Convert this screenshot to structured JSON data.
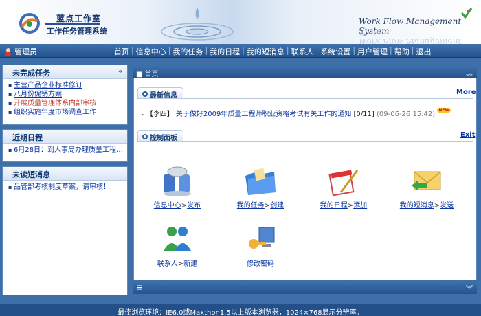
{
  "brand": {
    "line1": "蓝点工作室",
    "line2": "工作任务管理系统",
    "system_name": "Work Flow Management System"
  },
  "nav": {
    "user": "管理员",
    "items": [
      "首页",
      "信息中心",
      "我的任务",
      "我的日程",
      "我的短消息",
      "联系人",
      "系统设置",
      "用户管理",
      "帮助",
      "退出"
    ]
  },
  "sidebar": {
    "unfinished": {
      "title": "未完成任务",
      "collapse": "«",
      "items": [
        "主营产品企业标准修订",
        "八月份促销方案",
        "开展质量管理体系内部审核",
        "组织实施年度市场调查工作"
      ]
    },
    "schedule": {
      "title": "近期日程",
      "items": [
        "6月28日：到人事局办理质量工程…"
      ]
    },
    "messages": {
      "title": "未读短消息",
      "items": [
        "品管部考核制度草案，请审核！"
      ]
    }
  },
  "main": {
    "breadcrumb": "首页",
    "news": {
      "title": "最新信息",
      "more": "More",
      "item": {
        "author": "【李四】",
        "title": "关于做好2009年质量工程师职业资格考试有关工作的通知",
        "count": "[0/11]",
        "date": "(09-06-26 15:42)",
        "badge": "NEW"
      }
    },
    "control": {
      "title": "控制面板",
      "exit": "Exit",
      "gt": ">",
      "tiles": [
        {
          "name": "信息中心",
          "action": "发布"
        },
        {
          "name": "我的任务",
          "action": "创建"
        },
        {
          "name": "我的日程",
          "action": "添加"
        },
        {
          "name": "我的短消息",
          "action": "发送"
        },
        {
          "name": "联系人",
          "action": "新建"
        },
        {
          "name": "修改密码",
          "action": ""
        }
      ]
    }
  },
  "footer": "最佳浏览环境：IE6.0或Maxthon1.5以上版本浏览器，1024×768显示分辨率。",
  "colors": {
    "accent": "#24538e",
    "link": "#0a34a0",
    "alert": "#c0392b"
  }
}
